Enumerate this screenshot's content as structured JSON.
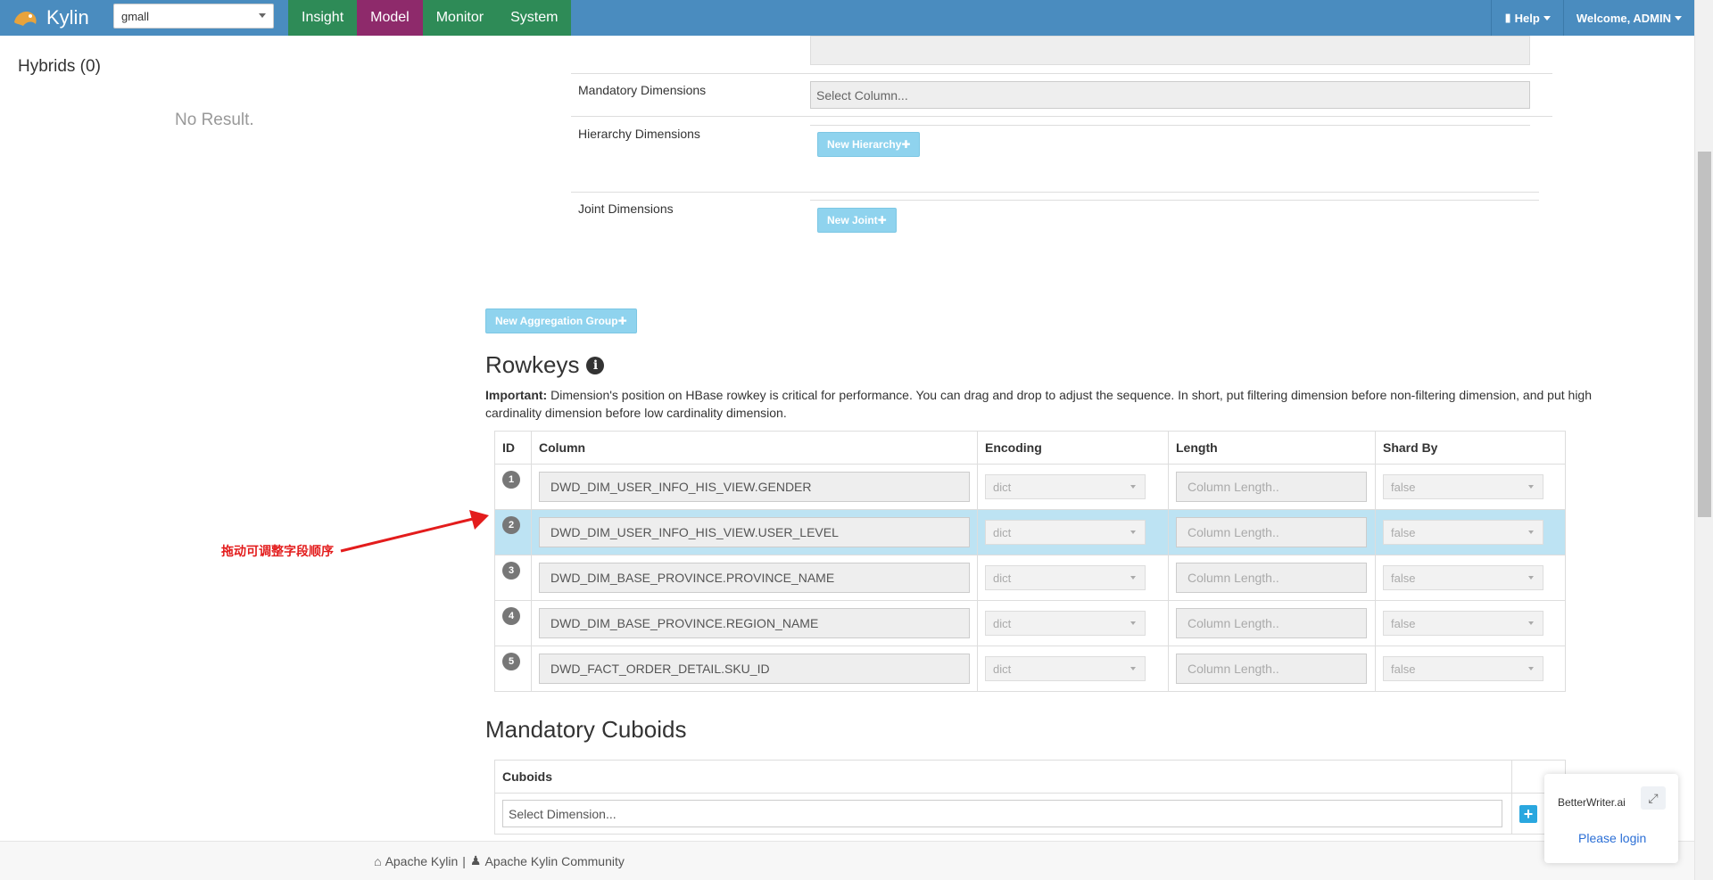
{
  "navbar": {
    "brand": "Kylin",
    "project": "gmall",
    "tabs": [
      "Insight",
      "Model",
      "Monitor",
      "System"
    ],
    "active_tab": "Model",
    "help": "Help",
    "welcome": "Welcome, ADMIN"
  },
  "left_panel": {
    "hybrids_title": "Hybrids (0)",
    "no_result": "No Result."
  },
  "aggregation": {
    "mandatory_label": "Mandatory Dimensions",
    "mandatory_placeholder": "Select Column...",
    "hierarchy_label": "Hierarchy Dimensions",
    "new_hierarchy": "New Hierarchy",
    "joint_label": "Joint Dimensions",
    "new_joint": "New Joint",
    "new_group": "New Aggregation Group"
  },
  "rowkeys": {
    "title": "Rowkeys",
    "note_bold": "Important:",
    "note_text": " Dimension's position on HBase rowkey is critical for performance. You can drag and drop to adjust the sequence. In short, put filtering dimension before non-filtering dimension, and put high cardinality dimension before low cardinality dimension.",
    "headers": [
      "ID",
      "Column",
      "Encoding",
      "Length",
      "Shard By"
    ],
    "length_placeholder": "Column Length..",
    "rows": [
      {
        "id": "1",
        "column": "DWD_DIM_USER_INFO_HIS_VIEW.GENDER",
        "encoding": "dict",
        "shard": "false"
      },
      {
        "id": "2",
        "column": "DWD_DIM_USER_INFO_HIS_VIEW.USER_LEVEL",
        "encoding": "dict",
        "shard": "false"
      },
      {
        "id": "3",
        "column": "DWD_DIM_BASE_PROVINCE.PROVINCE_NAME",
        "encoding": "dict",
        "shard": "false"
      },
      {
        "id": "4",
        "column": "DWD_DIM_BASE_PROVINCE.REGION_NAME",
        "encoding": "dict",
        "shard": "false"
      },
      {
        "id": "5",
        "column": "DWD_FACT_ORDER_DETAIL.SKU_ID",
        "encoding": "dict",
        "shard": "false"
      }
    ]
  },
  "annotation": {
    "text": "拖动可调整字段顺序",
    "color": "#e31c1c"
  },
  "mandatory_cuboids": {
    "title": "Mandatory Cuboids",
    "header": "Cuboids",
    "placeholder": "Select Dimension...",
    "add_label": "+"
  },
  "footer": {
    "link1": "Apache Kylin",
    "sep": "|",
    "link2": "Apache Kylin Community"
  },
  "widget": {
    "name": "BetterWriter.ai",
    "login": "Please login"
  }
}
